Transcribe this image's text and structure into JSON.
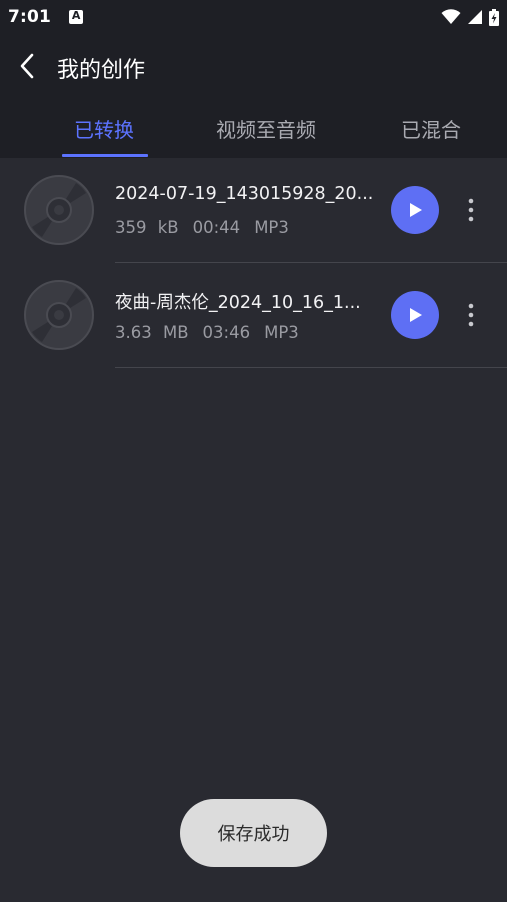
{
  "status_bar": {
    "time": "7:01",
    "notification_icon": "A",
    "icons": [
      "wifi-icon",
      "signal-icon",
      "battery-charging-icon"
    ]
  },
  "header": {
    "title": "我的创作",
    "back_icon": "chevron-left-icon"
  },
  "tabs": [
    {
      "label": "已转换",
      "active": true
    },
    {
      "label": "视频至音频",
      "active": false
    },
    {
      "label": "已混合",
      "active": false
    }
  ],
  "items": [
    {
      "title": "2024-07-19_143015928_20...",
      "size": "359 kB",
      "duration": "00:44",
      "format": "MP3"
    },
    {
      "title": "夜曲-周杰伦_2024_10_16_1...",
      "size": "3.63 MB",
      "duration": "03:46",
      "format": "MP3"
    }
  ],
  "toast": "保存成功",
  "colors": {
    "background": "#292a31",
    "header": "#1e1f25",
    "accent": "#5c73ff",
    "play_button": "#5e6ff4",
    "toast": "#dcdcdc"
  }
}
